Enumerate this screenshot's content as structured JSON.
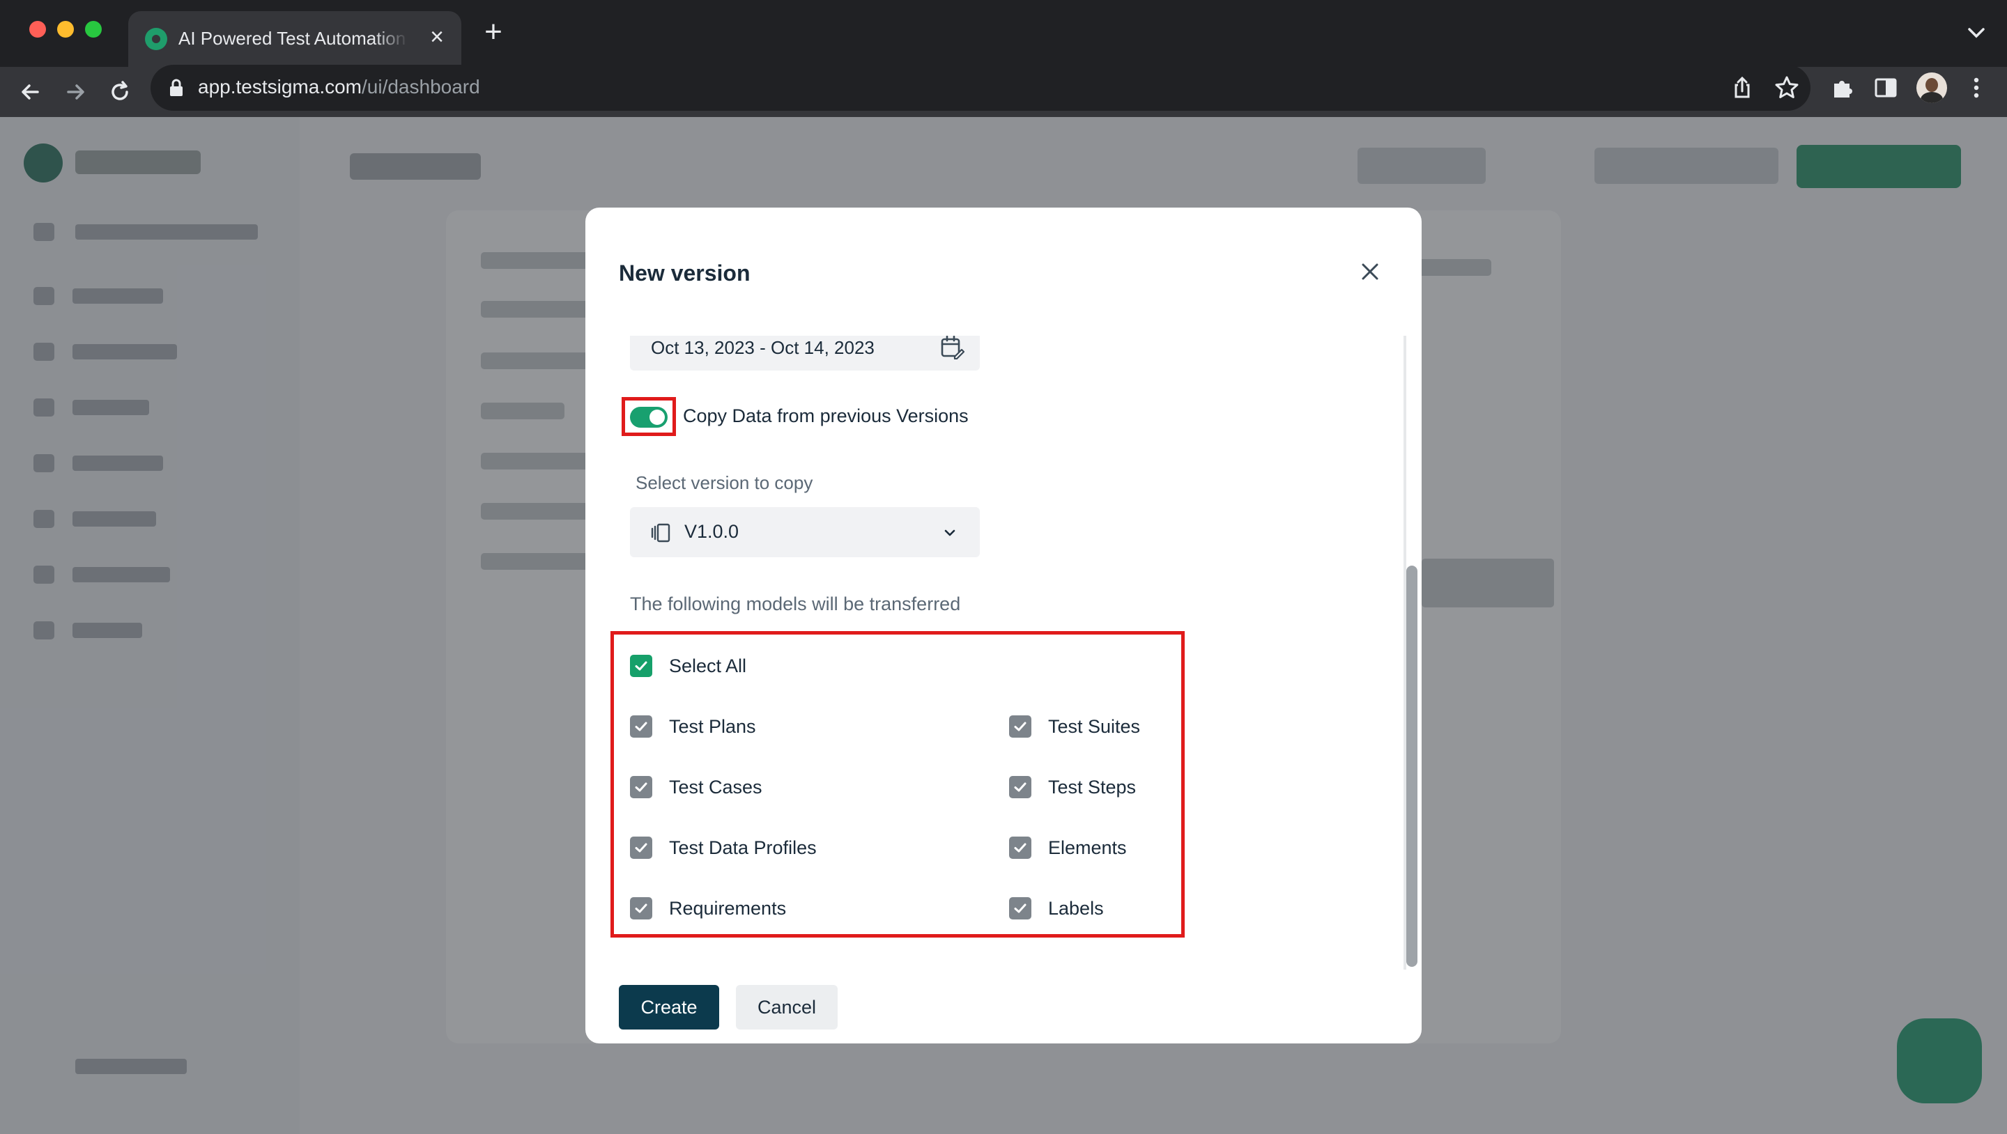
{
  "browser": {
    "tab_title": "AI Powered Test Automation Platform",
    "url_host": "app.testsigma.com",
    "url_path": "/ui/dashboard"
  },
  "modal": {
    "title": "New version",
    "date_range": "Oct 13, 2023 - Oct 14, 2023",
    "copy_toggle": {
      "label": "Copy Data from previous Versions",
      "on": true
    },
    "select_label": "Select version to copy",
    "selected_version": "V1.0.0",
    "models_label": "The following models will be transferred",
    "select_all": {
      "label": "Select All",
      "checked": true
    },
    "models": {
      "left": [
        {
          "label": "Test Plans",
          "checked": true
        },
        {
          "label": "Test Cases",
          "checked": true
        },
        {
          "label": "Test Data Profiles",
          "checked": true
        },
        {
          "label": "Requirements",
          "checked": true
        }
      ],
      "right": [
        {
          "label": "Test Suites",
          "checked": true
        },
        {
          "label": "Test Steps",
          "checked": true
        },
        {
          "label": "Elements",
          "checked": true
        },
        {
          "label": "Labels",
          "checked": true
        }
      ]
    },
    "buttons": {
      "create": "Create",
      "cancel": "Cancel"
    }
  },
  "colors": {
    "accent_green": "#16a06a",
    "primary_dark": "#0c3a4d",
    "highlight_red": "#e01b1b"
  }
}
